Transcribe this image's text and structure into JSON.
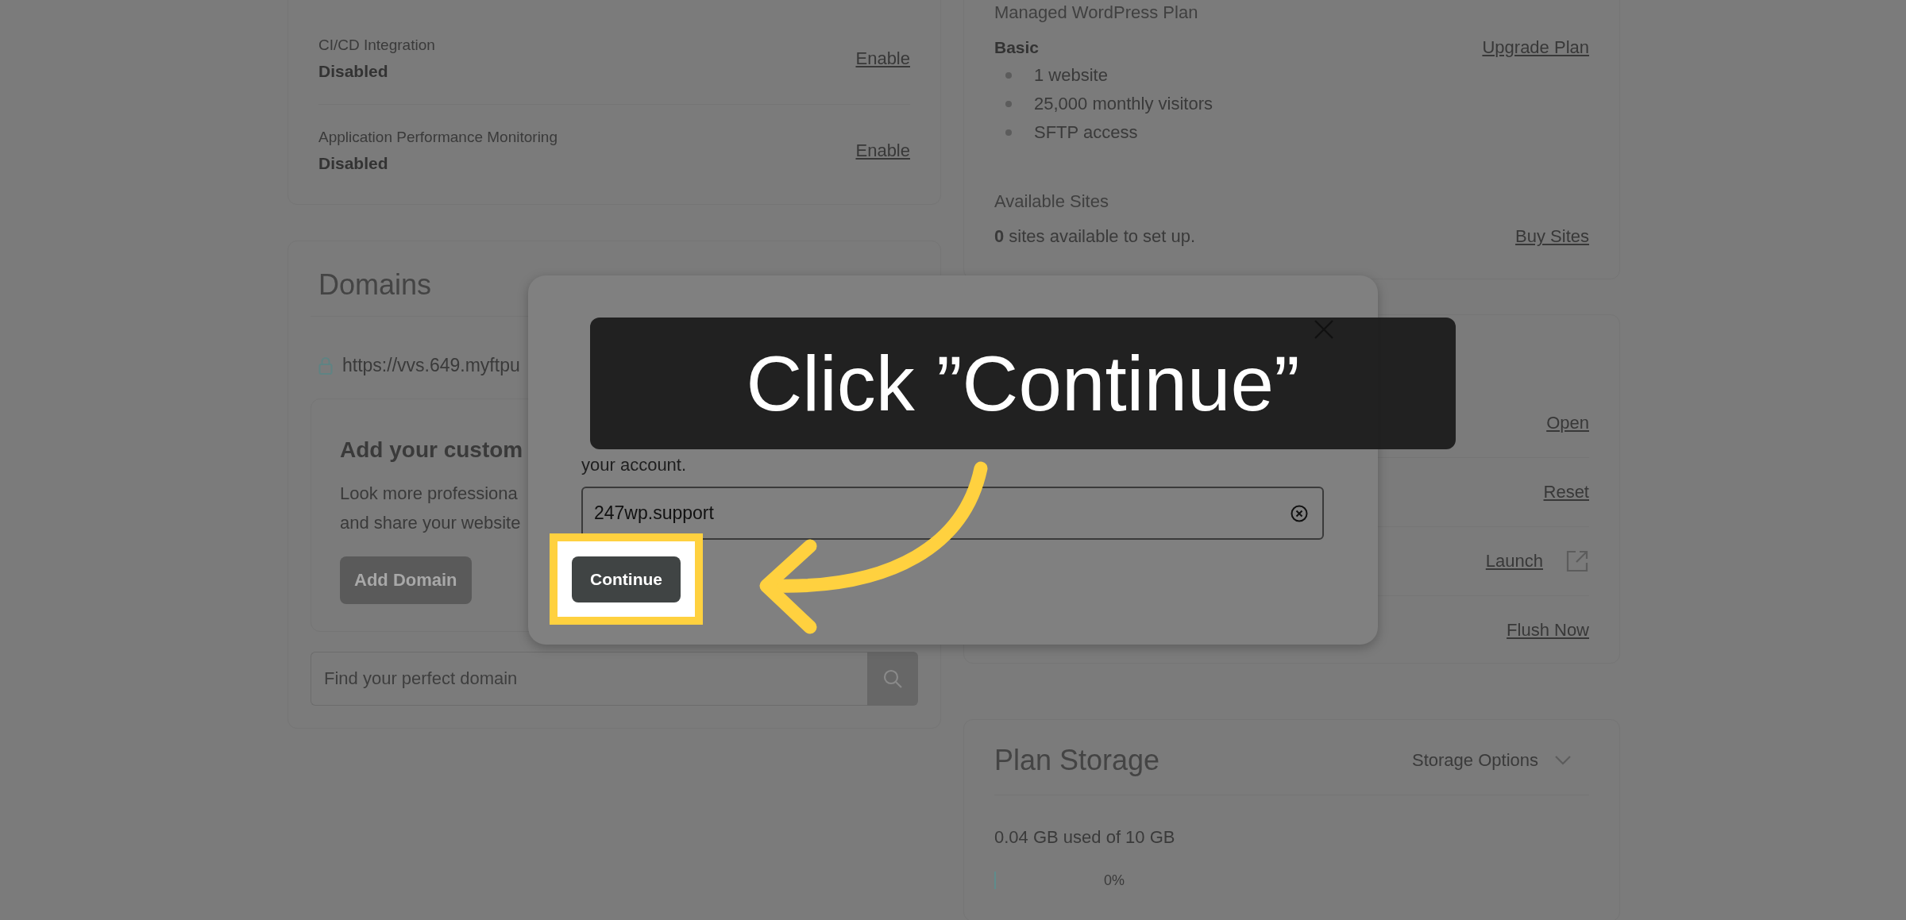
{
  "settings_rows": [
    {
      "label": "CI/CD Integration",
      "value": "Disabled",
      "action": "Enable"
    },
    {
      "label": "Application Performance Monitoring",
      "value": "Disabled",
      "action": "Enable"
    }
  ],
  "domains": {
    "title": "Domains",
    "url": "https://vvs.649.myftpu",
    "custom_card": {
      "title": "Add your custom",
      "text_lines": [
        "Look more professiona",
        "and share your website"
      ],
      "button": "Add Domain"
    },
    "search": {
      "placeholder": "Find your perfect domain"
    }
  },
  "plan": {
    "label": "Managed WordPress Plan",
    "name": "Basic",
    "action": "Upgrade Plan",
    "features": [
      "1 website",
      "25,000 monthly visitors",
      "SFTP access"
    ],
    "available_label": "Available Sites",
    "available_text": "**0** sites available to set up.",
    "available_action": "Buy Sites"
  },
  "tools": [
    {
      "action": "Open",
      "kind": "link"
    },
    {
      "action": "Reset",
      "kind": "link"
    },
    {
      "action": "Launch",
      "kind": "external"
    },
    {
      "action": "Flush Now",
      "kind": "link"
    }
  ],
  "storage": {
    "title": "Plan Storage",
    "options": "Storage Options",
    "usage": "0.04 GB used of 10 GB",
    "level": 0,
    "percent": "0%"
  },
  "dialog": {
    "description": "your account.",
    "input_value": "247wp.support",
    "button": "Continue"
  },
  "tutorial": {
    "caption": "Click ”Continue”"
  }
}
